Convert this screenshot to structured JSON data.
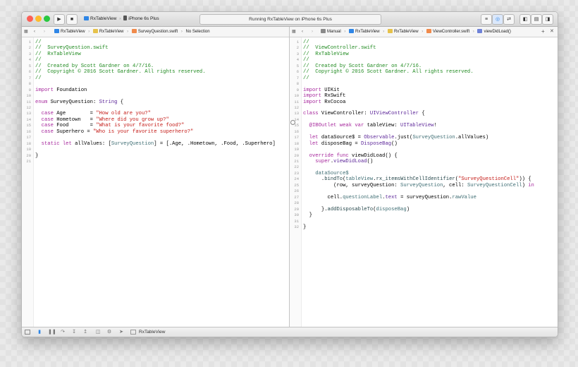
{
  "toolbar": {
    "scheme_target": "RxTableView",
    "scheme_device": "iPhone 6s Plus",
    "status": "Running RxTableView on iPhone 6s Plus"
  },
  "left_jumpbar": {
    "crumbs": [
      "RxTableView",
      "RxTableView",
      "SurveyQuestion.swift",
      "No Selection"
    ]
  },
  "right_jumpbar": {
    "mode": "Manual",
    "crumbs": [
      "RxTableView",
      "RxTableView",
      "ViewController.swift",
      "viewDidLoad()"
    ]
  },
  "bottom_bar": {
    "target": "RxTableView"
  },
  "left_editor": {
    "lines": [
      {
        "n": "1",
        "t": [
          {
            "c": "com",
            "s": "//"
          }
        ]
      },
      {
        "n": "2",
        "t": [
          {
            "c": "com",
            "s": "//  SurveyQuestion.swift"
          }
        ]
      },
      {
        "n": "3",
        "t": [
          {
            "c": "com",
            "s": "//  RxTableView"
          }
        ]
      },
      {
        "n": "4",
        "t": [
          {
            "c": "com",
            "s": "//"
          }
        ]
      },
      {
        "n": "5",
        "t": [
          {
            "c": "com",
            "s": "//  Created by Scott Gardner on 4/7/16."
          }
        ]
      },
      {
        "n": "6",
        "t": [
          {
            "c": "com",
            "s": "//  Copyright © 2016 Scott Gardner. All rights reserved."
          }
        ]
      },
      {
        "n": "7",
        "t": [
          {
            "c": "com",
            "s": "//"
          }
        ]
      },
      {
        "n": "8",
        "t": []
      },
      {
        "n": "9",
        "t": [
          {
            "c": "kw",
            "s": "import"
          },
          {
            "c": "",
            "s": " Foundation"
          }
        ]
      },
      {
        "n": "10",
        "t": []
      },
      {
        "n": "11",
        "t": [
          {
            "c": "kw",
            "s": "enum"
          },
          {
            "c": "",
            "s": " SurveyQuestion: "
          },
          {
            "c": "type",
            "s": "String"
          },
          {
            "c": "",
            "s": " {"
          }
        ]
      },
      {
        "n": "12",
        "t": []
      },
      {
        "n": "13",
        "t": [
          {
            "c": "",
            "s": "  "
          },
          {
            "c": "kw",
            "s": "case"
          },
          {
            "c": "",
            "s": " Age        = "
          },
          {
            "c": "str",
            "s": "\"How old are you?\""
          }
        ]
      },
      {
        "n": "14",
        "t": [
          {
            "c": "",
            "s": "  "
          },
          {
            "c": "kw",
            "s": "case"
          },
          {
            "c": "",
            "s": " Hometown   = "
          },
          {
            "c": "str",
            "s": "\"Where did you grow up?\""
          }
        ]
      },
      {
        "n": "15",
        "t": [
          {
            "c": "",
            "s": "  "
          },
          {
            "c": "kw",
            "s": "case"
          },
          {
            "c": "",
            "s": " Food       = "
          },
          {
            "c": "str",
            "s": "\"What is your favorite food?\""
          }
        ]
      },
      {
        "n": "16",
        "t": [
          {
            "c": "",
            "s": "  "
          },
          {
            "c": "kw",
            "s": "case"
          },
          {
            "c": "",
            "s": " Superhero = "
          },
          {
            "c": "str",
            "s": "\"Who is your favorite superhero?\""
          }
        ]
      },
      {
        "n": "17",
        "t": []
      },
      {
        "n": "18",
        "t": [
          {
            "c": "",
            "s": "  "
          },
          {
            "c": "kw",
            "s": "static let"
          },
          {
            "c": "",
            "s": " allValues: ["
          },
          {
            "c": "proj",
            "s": "SurveyQuestion"
          },
          {
            "c": "",
            "s": "] = [.Age, .Hometown, .Food, .Superhero]"
          }
        ]
      },
      {
        "n": "19",
        "t": []
      },
      {
        "n": "20",
        "t": [
          {
            "c": "",
            "s": "}"
          }
        ]
      },
      {
        "n": "21",
        "t": []
      }
    ]
  },
  "right_editor": {
    "lines": [
      {
        "n": "1",
        "t": [
          {
            "c": "com",
            "s": "//"
          }
        ]
      },
      {
        "n": "2",
        "t": [
          {
            "c": "com",
            "s": "//  ViewController.swift"
          }
        ]
      },
      {
        "n": "3",
        "t": [
          {
            "c": "com",
            "s": "//  RxTableView"
          }
        ]
      },
      {
        "n": "4",
        "t": [
          {
            "c": "com",
            "s": "//"
          }
        ]
      },
      {
        "n": "5",
        "t": [
          {
            "c": "com",
            "s": "//  Created by Scott Gardner on 4/7/16."
          }
        ]
      },
      {
        "n": "6",
        "t": [
          {
            "c": "com",
            "s": "//  Copyright © 2016 Scott Gardner. All rights reserved."
          }
        ]
      },
      {
        "n": "7",
        "t": [
          {
            "c": "com",
            "s": "//"
          }
        ]
      },
      {
        "n": "8",
        "t": []
      },
      {
        "n": "9",
        "t": [
          {
            "c": "kw",
            "s": "import"
          },
          {
            "c": "",
            "s": " UIKit"
          }
        ]
      },
      {
        "n": "10",
        "t": [
          {
            "c": "kw",
            "s": "import"
          },
          {
            "c": "",
            "s": " RxSwift"
          }
        ]
      },
      {
        "n": "11",
        "t": [
          {
            "c": "kw",
            "s": "import"
          },
          {
            "c": "",
            "s": " RxCocoa"
          }
        ]
      },
      {
        "n": "12",
        "t": []
      },
      {
        "n": "13",
        "t": [
          {
            "c": "kw",
            "s": "class"
          },
          {
            "c": "",
            "s": " ViewController: "
          },
          {
            "c": "type",
            "s": "UIViewController"
          },
          {
            "c": "",
            "s": " {"
          }
        ]
      },
      {
        "n": "14",
        "t": []
      },
      {
        "n": "15",
        "t": [
          {
            "c": "",
            "s": "  "
          },
          {
            "c": "kw",
            "s": "@IBOutlet weak var"
          },
          {
            "c": "",
            "s": " tableView: "
          },
          {
            "c": "type",
            "s": "UITableView"
          },
          {
            "c": "",
            "s": "!"
          }
        ]
      },
      {
        "n": "16",
        "t": []
      },
      {
        "n": "17",
        "t": [
          {
            "c": "",
            "s": "  "
          },
          {
            "c": "kw",
            "s": "let"
          },
          {
            "c": "",
            "s": " dataSource$ = "
          },
          {
            "c": "type",
            "s": "Observable"
          },
          {
            "c": "",
            "s": ".just("
          },
          {
            "c": "proj",
            "s": "SurveyQuestion"
          },
          {
            "c": "",
            "s": ".allValues)"
          }
        ]
      },
      {
        "n": "18",
        "t": [
          {
            "c": "",
            "s": "  "
          },
          {
            "c": "kw",
            "s": "let"
          },
          {
            "c": "",
            "s": " disposeBag = "
          },
          {
            "c": "type",
            "s": "DisposeBag"
          },
          {
            "c": "",
            "s": "()"
          }
        ]
      },
      {
        "n": "19",
        "t": []
      },
      {
        "n": "20",
        "t": [
          {
            "c": "",
            "s": "  "
          },
          {
            "c": "kw",
            "s": "override func"
          },
          {
            "c": "",
            "s": " viewDidLoad() {"
          }
        ]
      },
      {
        "n": "21",
        "t": [
          {
            "c": "",
            "s": "    "
          },
          {
            "c": "kw",
            "s": "super"
          },
          {
            "c": "",
            "s": "."
          },
          {
            "c": "type",
            "s": "viewDidLoad"
          },
          {
            "c": "",
            "s": "()"
          }
        ]
      },
      {
        "n": "22",
        "t": []
      },
      {
        "n": "23",
        "t": [
          {
            "c": "",
            "s": "    "
          },
          {
            "c": "proj",
            "s": "dataSource$"
          }
        ]
      },
      {
        "n": "24",
        "t": [
          {
            "c": "",
            "s": "      ."
          },
          {
            "c": "proj2",
            "s": "bindTo"
          },
          {
            "c": "",
            "s": "("
          },
          {
            "c": "proj",
            "s": "tableView"
          },
          {
            "c": "",
            "s": "."
          },
          {
            "c": "proj2",
            "s": "rx_itemsWithCellIdentifier"
          },
          {
            "c": "",
            "s": "("
          },
          {
            "c": "str",
            "s": "\"SurveyQuestionCell\""
          },
          {
            "c": "",
            "s": ")) {"
          }
        ]
      },
      {
        "n": "25",
        "t": [
          {
            "c": "",
            "s": "          (row, surveyQuestion: "
          },
          {
            "c": "proj",
            "s": "SurveyQuestion"
          },
          {
            "c": "",
            "s": ", cell: "
          },
          {
            "c": "proj",
            "s": "SurveyQuestionCell"
          },
          {
            "c": "",
            "s": ") "
          },
          {
            "c": "kw",
            "s": "in"
          }
        ]
      },
      {
        "n": "26",
        "t": []
      },
      {
        "n": "27",
        "t": [
          {
            "c": "",
            "s": "        cell."
          },
          {
            "c": "proj",
            "s": "questionLabel"
          },
          {
            "c": "",
            "s": "."
          },
          {
            "c": "type",
            "s": "text"
          },
          {
            "c": "",
            "s": " = surveyQuestion."
          },
          {
            "c": "proj",
            "s": "rawValue"
          }
        ]
      },
      {
        "n": "28",
        "t": []
      },
      {
        "n": "29",
        "t": [
          {
            "c": "",
            "s": "      }."
          },
          {
            "c": "proj2",
            "s": "addDisposableTo"
          },
          {
            "c": "",
            "s": "("
          },
          {
            "c": "proj",
            "s": "disposeBag"
          },
          {
            "c": "",
            "s": ")"
          }
        ]
      },
      {
        "n": "30",
        "t": [
          {
            "c": "",
            "s": "  }"
          }
        ]
      },
      {
        "n": "31",
        "t": []
      },
      {
        "n": "32",
        "t": [
          {
            "c": "",
            "s": "}"
          }
        ]
      }
    ]
  }
}
